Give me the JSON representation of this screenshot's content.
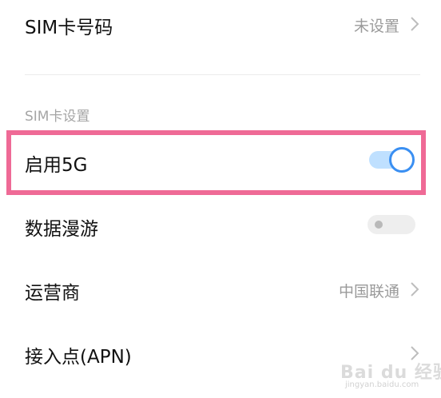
{
  "sim_number": {
    "label": "SIM卡号码",
    "value": "未设置"
  },
  "section": {
    "title": "SIM卡设置"
  },
  "enable_5g": {
    "label": "启用5G",
    "on": true
  },
  "data_roaming": {
    "label": "数据漫游",
    "on": false
  },
  "carrier": {
    "label": "运营商",
    "value": "中国联通"
  },
  "apn": {
    "label": "接入点(APN)"
  },
  "watermark": {
    "brand": "Bai du 经验",
    "url": "jingyan.baidu.com"
  },
  "colors": {
    "highlight_border": "#ef6a96",
    "toggle_on_track": "#bfe0ff",
    "toggle_on_knob": "#3a8ff2",
    "toggle_off_track": "#eeeeee"
  }
}
